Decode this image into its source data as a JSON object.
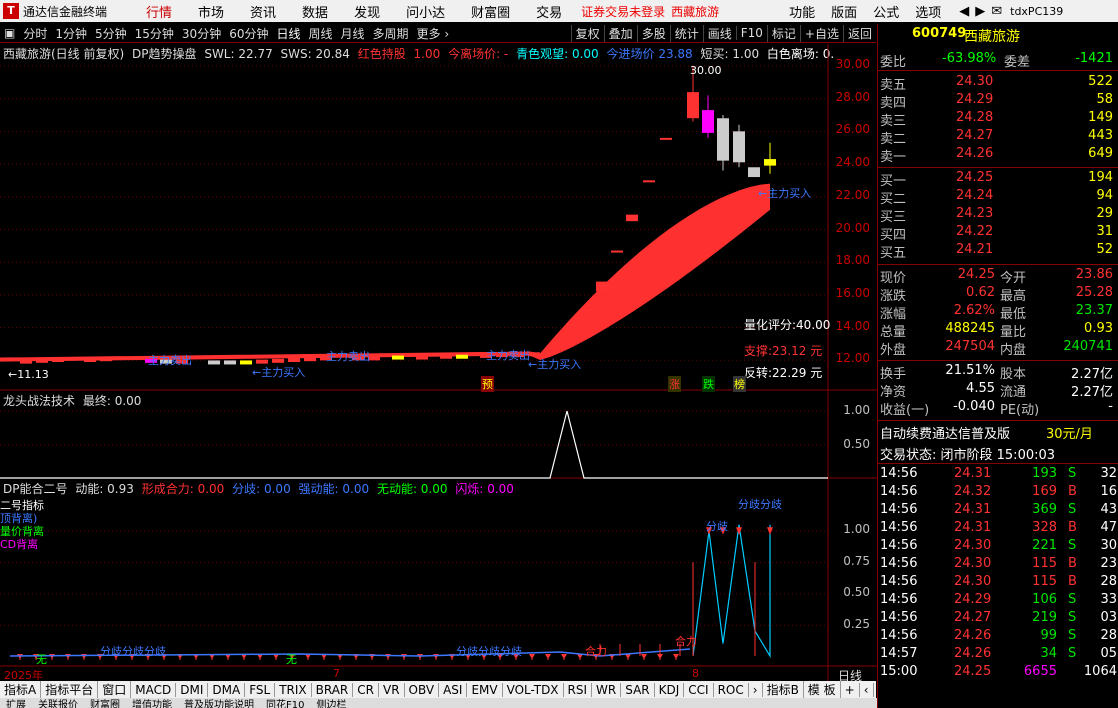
{
  "app": {
    "name": "通达信金融终端",
    "logo": "T",
    "menu": [
      "行情",
      "市场",
      "资讯",
      "数据",
      "发现",
      "问小达",
      "财富圈",
      "交易"
    ],
    "active_menu": "行情",
    "promo_1": "证券交易未登录",
    "promo_2": "西藏旅游",
    "right_menu": [
      "功能",
      "版面",
      "公式",
      "选项"
    ],
    "user": "tdxPC139"
  },
  "toolbar": {
    "periods": [
      "分时",
      "1分钟",
      "5分钟",
      "15分钟",
      "30分钟",
      "60分钟",
      "日线",
      "周线",
      "月线",
      "多周期",
      "更多 ›"
    ],
    "selected_period": "日线",
    "tools": [
      "复权",
      "叠加",
      "多股",
      "统计",
      "画线",
      "F10",
      "标记",
      "+自选",
      "返回"
    ]
  },
  "main_panel": {
    "title": "西藏旅游(日线 前复权)",
    "indicator": "DP趋势操盘",
    "swl": "SWL: 22.77",
    "sws": "SWS: 20.84",
    "red_hold": "红色持股",
    "red_hold_val": "1.00",
    "leave_price": "今离场价: -",
    "cyan_watch": "青色观望: 0.00",
    "today_price": "今进场价 23.88",
    "short_buy": "短买: 1.00",
    "white_leave": "白色离场: 0.",
    "high_label": "30.00",
    "low_label": "←11.13",
    "quant": "量化评分:40.00",
    "support": "支撑:23.12 元",
    "reversal": "反转:22.29 元",
    "main_buy": "←主力买入",
    "main_sell": "主力卖出",
    "marks": [
      "预",
      "涨",
      "跌",
      "榜"
    ],
    "y_ticks": [
      "30.00",
      "28.00",
      "26.00",
      "24.00",
      "22.00",
      "20.00",
      "18.00",
      "16.00",
      "14.00",
      "12.00"
    ]
  },
  "panel2": {
    "title": "龙头战法技术",
    "value": "最终: 0.00",
    "y_ticks": [
      "1.00",
      "0.50"
    ]
  },
  "panel3": {
    "title": "DP能合二号",
    "dongneng": "动能: 0.93",
    "xingcheng": "形成合力: 0.00",
    "fenqi": "分歧: 0.00",
    "qiangdong": "强动能: 0.00",
    "wudong": "无动能: 0.00",
    "shanshuo": "闪烁: 0.00",
    "legend": [
      "二号指标",
      "顶背离)",
      "量价背离",
      "CD背离"
    ],
    "labels": {
      "fenqi": "分歧",
      "fenqi2": "分歧分歧",
      "hj": "合力",
      "wu": "无",
      "fhq": "分歧分歧分歧"
    },
    "y_ticks": [
      "1.00",
      "0.75",
      "0.50",
      "0.25"
    ],
    "x_labels": [
      "2025年",
      "7",
      "8"
    ],
    "period": "日线"
  },
  "bottom_tabs": [
    "指标A",
    "指标平台",
    "窗口",
    "MACD",
    "DMI",
    "DMA",
    "FSL",
    "TRIX",
    "BRAR",
    "CR",
    "VR",
    "OBV",
    "ASI",
    "EMV",
    "VOL-TDX",
    "RSI",
    "WR",
    "SAR",
    "KDJ",
    "CCI",
    "ROC",
    "›",
    "指标B",
    "模 板",
    "+",
    "‹"
  ],
  "bottom2": [
    "扩展",
    "关联报价",
    "财富圈",
    "增值功能",
    "普及版功能说明",
    "同花F10",
    "侧边栏"
  ],
  "quote": {
    "code": "600749",
    "name": "西藏旅游",
    "weibi_label": "委比",
    "weibi": "-63.98%",
    "weicha_label": "委差",
    "weicha": "-1421",
    "asks": [
      {
        "label": "卖五",
        "price": "24.30",
        "vol": "522"
      },
      {
        "label": "卖四",
        "price": "24.29",
        "vol": "58"
      },
      {
        "label": "卖三",
        "price": "24.28",
        "vol": "149"
      },
      {
        "label": "卖二",
        "price": "24.27",
        "vol": "443"
      },
      {
        "label": "卖一",
        "price": "24.26",
        "vol": "649"
      }
    ],
    "bids": [
      {
        "label": "买一",
        "price": "24.25",
        "vol": "194"
      },
      {
        "label": "买二",
        "price": "24.24",
        "vol": "94"
      },
      {
        "label": "买三",
        "price": "24.23",
        "vol": "29"
      },
      {
        "label": "买四",
        "price": "24.22",
        "vol": "31"
      },
      {
        "label": "买五",
        "price": "24.21",
        "vol": "52"
      }
    ],
    "stats": [
      {
        "l1": "现价",
        "v1": "24.25",
        "l2": "今开",
        "v2": "23.86",
        "c1": "red",
        "c2": "red"
      },
      {
        "l1": "涨跌",
        "v1": "0.62",
        "l2": "最高",
        "v2": "25.28",
        "c1": "red",
        "c2": "red"
      },
      {
        "l1": "涨幅",
        "v1": "2.62%",
        "l2": "最低",
        "v2": "23.37",
        "c1": "red",
        "c2": "grn"
      },
      {
        "l1": "总量",
        "v1": "488245",
        "l2": "量比",
        "v2": "0.93",
        "c1": "yel",
        "c2": "yel"
      },
      {
        "l1": "外盘",
        "v1": "247504",
        "l2": "内盘",
        "v2": "240741",
        "c1": "red",
        "c2": "grn"
      }
    ],
    "stats2": [
      {
        "l1": "换手",
        "v1": "21.51%",
        "l2": "股本",
        "v2": "2.27亿"
      },
      {
        "l1": "净资",
        "v1": "4.55",
        "l2": "流通",
        "v2": "2.27亿"
      },
      {
        "l1": "收益(一)",
        "v1": "-0.040",
        "l2": "PE(动)",
        "v2": "-"
      }
    ],
    "ad": "自动续费通达信普及版",
    "ad_price": "30元/月",
    "status": "交易状态: 闭市阶段 15:00:03",
    "ticks": [
      {
        "t": "14:56",
        "p": "24.31",
        "v": "193",
        "d": "S",
        "n": "32"
      },
      {
        "t": "14:56",
        "p": "24.32",
        "v": "169",
        "d": "B",
        "n": "16"
      },
      {
        "t": "14:56",
        "p": "24.31",
        "v": "369",
        "d": "S",
        "n": "43"
      },
      {
        "t": "14:56",
        "p": "24.31",
        "v": "328",
        "d": "B",
        "n": "47"
      },
      {
        "t": "14:56",
        "p": "24.30",
        "v": "221",
        "d": "S",
        "n": "30"
      },
      {
        "t": "14:56",
        "p": "24.30",
        "v": "115",
        "d": "B",
        "n": "23"
      },
      {
        "t": "14:56",
        "p": "24.30",
        "v": "115",
        "d": "B",
        "n": "28"
      },
      {
        "t": "14:56",
        "p": "24.29",
        "v": "106",
        "d": "S",
        "n": "33"
      },
      {
        "t": "14:56",
        "p": "24.27",
        "v": "219",
        "d": "S",
        "n": "03"
      },
      {
        "t": "14:56",
        "p": "24.26",
        "v": "99",
        "d": "S",
        "n": "28"
      },
      {
        "t": "14:57",
        "p": "24.26",
        "v": "34",
        "d": "S",
        "n": "05"
      },
      {
        "t": "15:00",
        "p": "24.25",
        "v": "6655",
        "d": "",
        "n": "1064"
      }
    ]
  },
  "colors": {
    "up": "#ff3232",
    "down": "#00ffff",
    "ribbon": "#ff3030",
    "grid": "#800000"
  }
}
